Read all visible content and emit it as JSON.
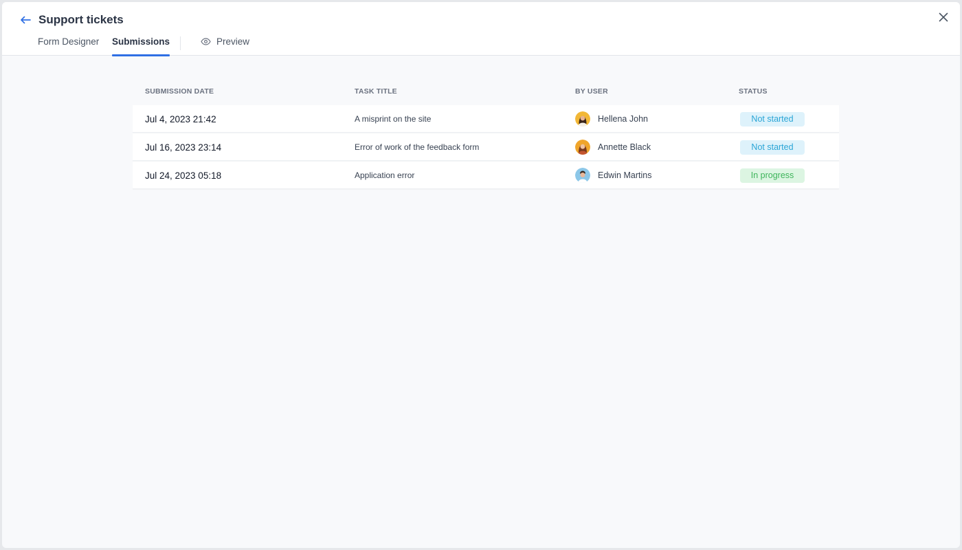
{
  "header": {
    "title": "Support tickets",
    "tabs": [
      {
        "label": "Form Designer",
        "active": false
      },
      {
        "label": "Submissions",
        "active": true
      },
      {
        "label": "Preview",
        "active": false
      }
    ]
  },
  "table": {
    "columns": [
      "SUBMISSION DATE",
      "TASK TITLE",
      "BY USER",
      "STATUS"
    ],
    "rows": [
      {
        "date": "Jul 4, 2023 21:42",
        "task": "A misprint on the site",
        "user": "Hellena John",
        "status": "Not started"
      },
      {
        "date": "Jul 16, 2023 23:14",
        "task": "Error of work of the feedback form",
        "user": "Annette Black",
        "status": "Not started"
      },
      {
        "date": "Jul 24, 2023 05:18",
        "task": "Application error",
        "user": "Edwin Martins",
        "status": "In progress"
      }
    ]
  },
  "colors": {
    "accent": "#2f6fe4",
    "not_started_bg": "#def2fb",
    "not_started_text": "#2aa5d6",
    "in_progress_bg": "#dcf5e2",
    "in_progress_text": "#3db45a"
  },
  "icons": {
    "back": "arrow-left-icon",
    "close": "close-icon",
    "preview": "eye-icon"
  }
}
